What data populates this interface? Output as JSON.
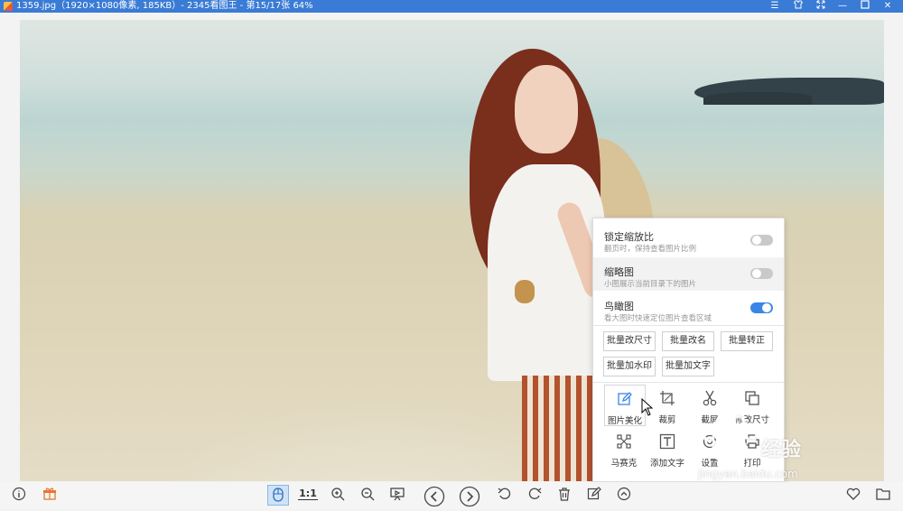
{
  "window": {
    "title": "1359.jpg（1920×1080像素, 185KB）- 2345看图王 - 第15/17张 64%",
    "controls": [
      "menu-icon",
      "skin-icon",
      "fullscreen-icon",
      "minimize-icon",
      "maximize-icon",
      "close-icon"
    ]
  },
  "menu": {
    "options": [
      {
        "title": "锁定缩放比",
        "subtitle": "翻页时，保持查看图片比例",
        "enabled": false
      },
      {
        "title": "缩略图",
        "subtitle": "小图展示当前目录下的图片",
        "enabled": false
      },
      {
        "title": "鸟瞰图",
        "subtitle": "看大图时快速定位图片查看区域",
        "enabled": true
      }
    ],
    "batch_buttons": [
      "批量改尺寸",
      "批量改名",
      "批量转正",
      "批量加水印",
      "批量加文字"
    ],
    "tools": [
      {
        "label": "图片美化",
        "icon": "pencil-icon"
      },
      {
        "label": "裁剪",
        "icon": "crop-icon"
      },
      {
        "label": "截屏",
        "icon": "scissors-icon"
      },
      {
        "label": "修改尺寸",
        "icon": "resize-icon"
      },
      {
        "label": "马赛克",
        "icon": "mosaic-icon"
      },
      {
        "label": "添加文字",
        "icon": "add-text-icon"
      },
      {
        "label": "设置",
        "icon": "settings-icon"
      },
      {
        "label": "打印",
        "icon": "print-icon"
      }
    ]
  },
  "toolbar": {
    "actual_size_label": "1:1"
  },
  "watermark": {
    "brand": "经验",
    "url": "jingyan.baidu.com"
  }
}
